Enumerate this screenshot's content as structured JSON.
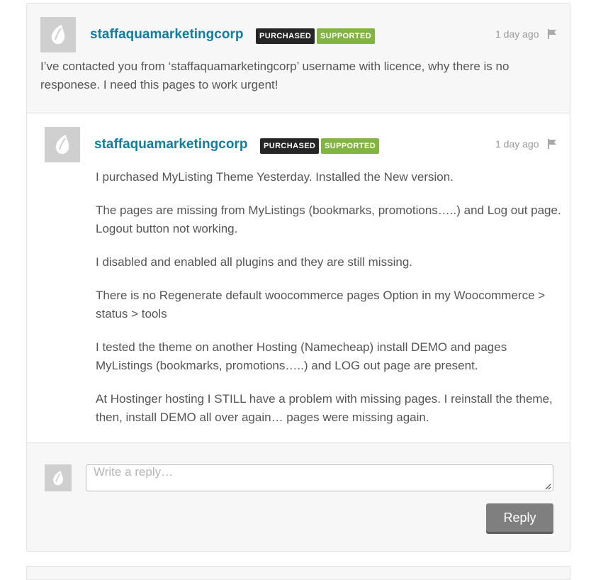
{
  "parent_comment": {
    "username": "staffaquamarketingcorp",
    "badges": {
      "purchased": "PURCHASED",
      "supported": "SUPPORTED"
    },
    "time": "1 day ago",
    "text": "I’ve contacted you from ‘staffaquamarketingcorp’ username with licence, why there is no responese. I need this pages to work urgent!"
  },
  "reply_comment": {
    "username": "staffaquamarketingcorp",
    "badges": {
      "purchased": "PURCHASED",
      "supported": "SUPPORTED"
    },
    "time": "1 day ago",
    "paragraphs": [
      "I purchased MyListing Theme Yesterday. Installed the New version.",
      "The pages are missing from MyListings (bookmarks, promotions…..) and Log out page. Logout button not working.",
      "I disabled and enabled all plugins and they are still missing.",
      "There is no Regenerate default woocommerce pages Option in my Woocommerce > status > tools",
      "I tested the theme on another Hosting (Namecheap) install DEMO and pages MyListings (bookmarks, promotions…..) and LOG out page are present.",
      "At Hostinger hosting I STILL have a problem with missing pages. I reinstall the theme, then, install DEMO all over again… pages were missing again."
    ]
  },
  "reply_form": {
    "placeholder": "Write a reply…",
    "button_label": "Reply"
  },
  "icons": {
    "avatar": "envato-leaf-icon",
    "flag": "flag-icon"
  },
  "colors": {
    "username": "#137da0",
    "purchased_badge": "#262626",
    "supported_badge": "#81b441",
    "reply_button": "#7f7f7f"
  }
}
